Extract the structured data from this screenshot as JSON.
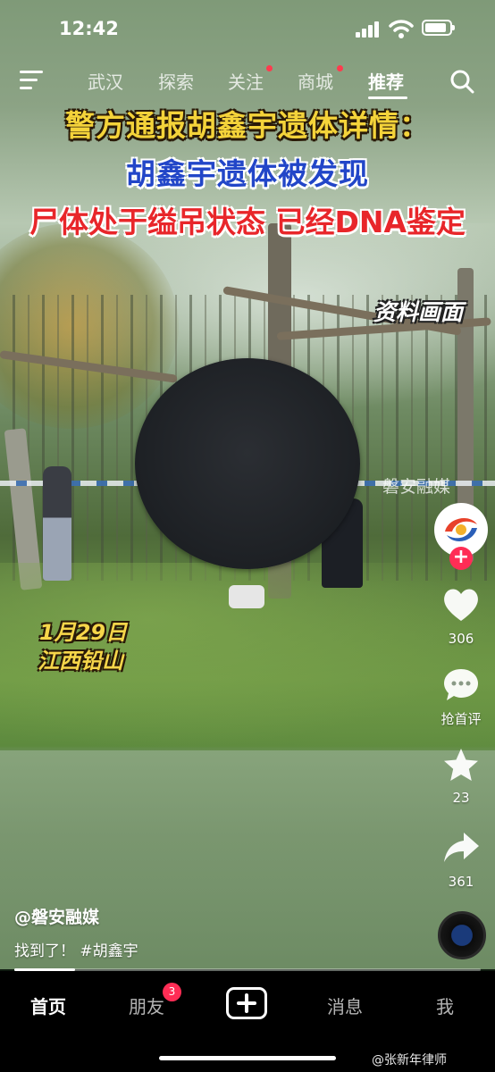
{
  "status_bar": {
    "time": "12:42"
  },
  "top_nav": {
    "tabs": [
      "武汉",
      "探索",
      "关注",
      "商城",
      "推荐"
    ],
    "active_tab": "推荐"
  },
  "video": {
    "caption_line1": "警方通报胡鑫宇遗体详情：",
    "caption_line2": "胡鑫宇遗体被发现",
    "caption_line3": "尸体处于缢吊状态 已经DNA鉴定",
    "stamp": "资料画面",
    "date_line1": "1月29日",
    "date_line2": "江西铅山",
    "watermark": "磐安融媒"
  },
  "rail": {
    "like_count": "306",
    "comment_label": "抢首评",
    "favorite_count": "23",
    "share_count": "361"
  },
  "post": {
    "author": "@磐安融媒",
    "description": "找到了！ #胡鑫宇",
    "progress": 0.13
  },
  "bottom_nav": {
    "items": [
      "首页",
      "朋友",
      "消息",
      "我"
    ],
    "friends_badge": "3"
  },
  "weibo_watermark": "@张新年律师",
  "colors": {
    "accent_red": "#ff2d55",
    "caption_yellow": "#f4d33a",
    "caption_blue": "#2246c8",
    "caption_red": "#e8262a"
  }
}
